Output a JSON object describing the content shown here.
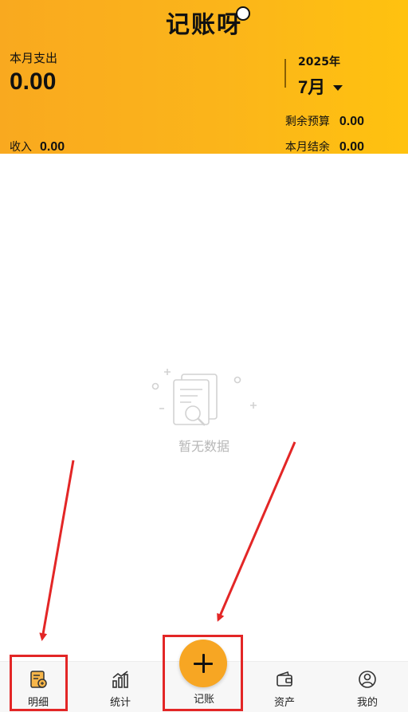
{
  "header": {
    "app_title": "记账呀",
    "month_expense_label": "本月支出",
    "month_expense_value": "0.00",
    "income_label": "收入",
    "income_value": "0.00",
    "year": "2025年",
    "month": "7月",
    "budget_label": "剩余预算",
    "budget_value": "0.00",
    "balance_label": "本月结余",
    "balance_value": "0.00"
  },
  "empty_state": {
    "text": "暂无数据",
    "icon": "no-data-illustration"
  },
  "tabbar": {
    "items": [
      {
        "label": "明细",
        "icon": "detail-icon",
        "active": true
      },
      {
        "label": "统计",
        "icon": "stats-icon"
      },
      {
        "label": "记账",
        "icon": "plus-icon"
      },
      {
        "label": "资产",
        "icon": "wallet-icon"
      },
      {
        "label": "我的",
        "icon": "profile-icon"
      }
    ]
  },
  "colors": {
    "header_gradient_start": "#f9a91f",
    "header_gradient_end": "#ffc20f",
    "accent": "#f7a623",
    "annotation": "#e32626"
  }
}
